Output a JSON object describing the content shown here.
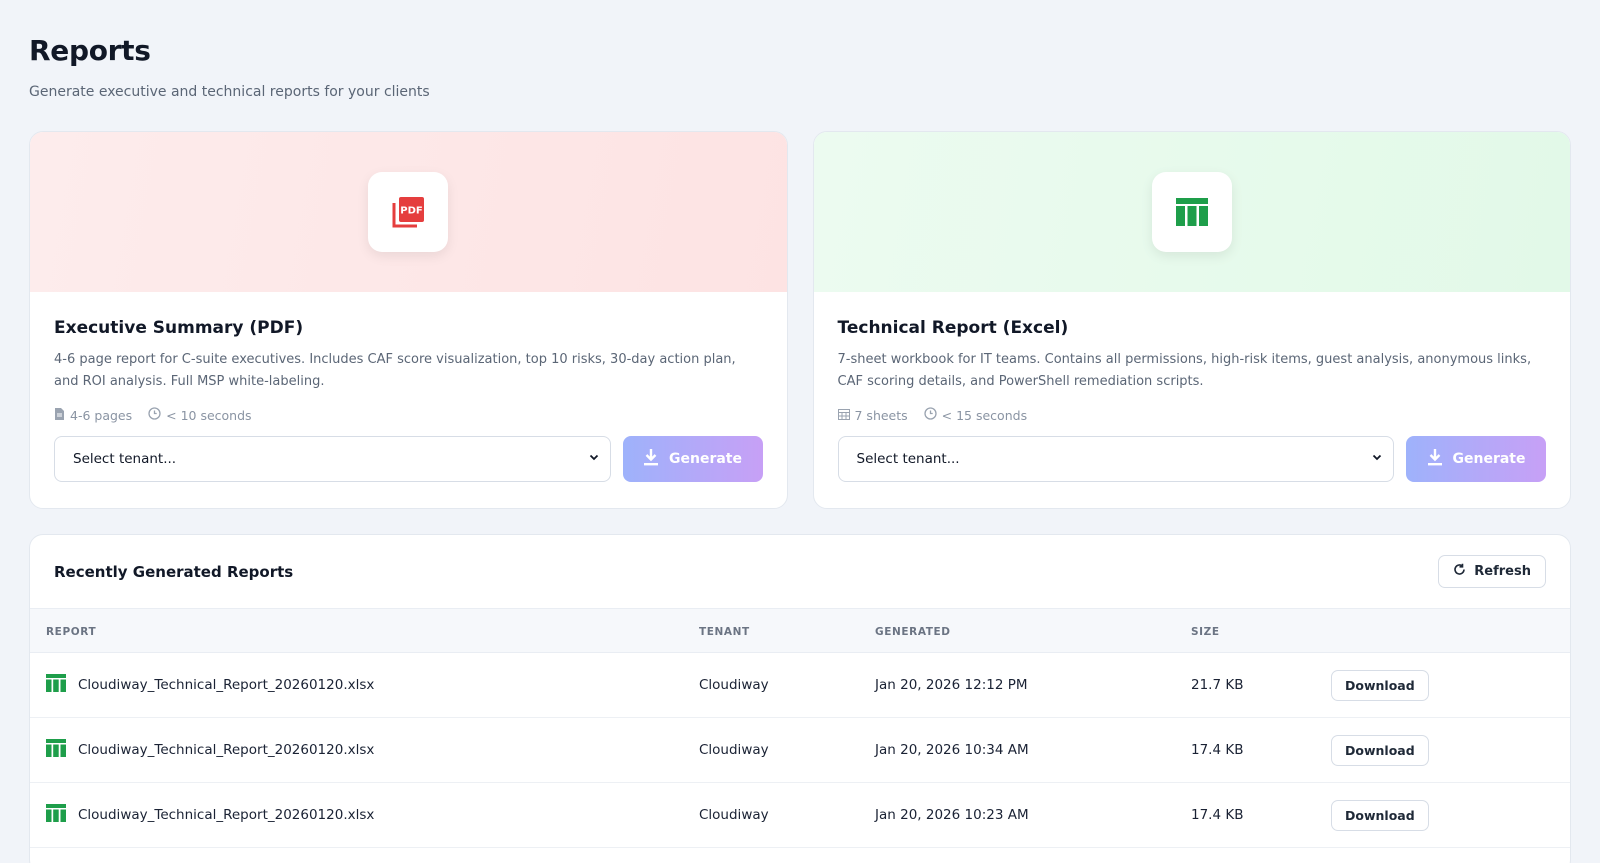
{
  "page": {
    "title": "Reports",
    "subtitle": "Generate executive and technical reports for your clients"
  },
  "cards": [
    {
      "title": "Executive Summary (PDF)",
      "description": "4-6 page report for C-suite executives. Includes CAF score visualization, top 10 risks, 30-day action plan, and ROI analysis. Full MSP white-labeling.",
      "meta_size": "4-6 pages",
      "meta_time": "< 10 seconds",
      "select_value": "Select tenant...",
      "button_label": "Generate",
      "icon": "pdf-icon",
      "accent": "#e53e3e"
    },
    {
      "title": "Technical Report (Excel)",
      "description": "7-sheet workbook for IT teams. Contains all permissions, high-risk items, guest analysis, anonymous links, CAF scoring details, and PowerShell remediation scripts.",
      "meta_size": "7 sheets",
      "meta_time": "< 15 seconds",
      "select_value": "Select tenant...",
      "button_label": "Generate",
      "icon": "spreadsheet-icon",
      "accent": "#1e9e4a"
    }
  ],
  "recent": {
    "title": "Recently Generated Reports",
    "refresh_label": "Refresh",
    "columns": [
      "REPORT",
      "TENANT",
      "GENERATED",
      "SIZE"
    ],
    "rows": [
      {
        "file": "Cloudiway_Technical_Report_20260120.xlsx",
        "tenant": "Cloudiway",
        "generated": "Jan 20, 2026 12:12 PM",
        "size": "21.7 KB",
        "action": "Download"
      },
      {
        "file": "Cloudiway_Technical_Report_20260120.xlsx",
        "tenant": "Cloudiway",
        "generated": "Jan 20, 2026 10:34 AM",
        "size": "17.4 KB",
        "action": "Download"
      },
      {
        "file": "Cloudiway_Technical_Report_20260120.xlsx",
        "tenant": "Cloudiway",
        "generated": "Jan 20, 2026 10:23 AM",
        "size": "17.4 KB",
        "action": "Download"
      }
    ]
  }
}
